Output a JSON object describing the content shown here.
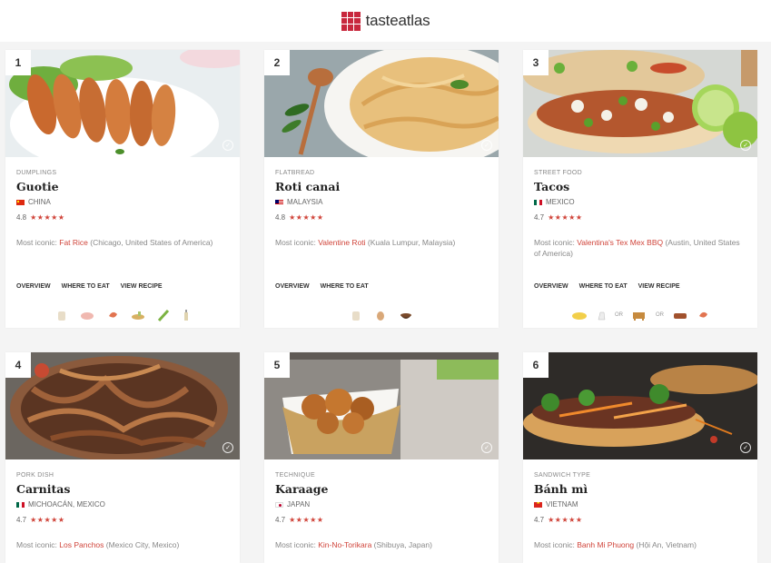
{
  "header": {
    "logo_text": "tasteatlas"
  },
  "labels": {
    "most_iconic": "Most iconic: ",
    "check": "✓"
  },
  "cards": [
    {
      "rank": "1",
      "category": "DUMPLINGS",
      "name": "Guotie",
      "country": "CHINA",
      "rating": "4.8",
      "stars": "★★★★★",
      "iconic_place": "Fat Rice",
      "iconic_location": " (Chicago, United States of America)",
      "actions": [
        "OVERVIEW",
        "WHERE TO EAT",
        "VIEW RECIPE"
      ]
    },
    {
      "rank": "2",
      "category": "FLATBREAD",
      "name": "Roti canai",
      "country": "MALAYSIA",
      "rating": "4.8",
      "stars": "★★★★★",
      "iconic_place": "Valentine Roti",
      "iconic_location": " (Kuala Lumpur, Malaysia)",
      "actions": [
        "OVERVIEW",
        "WHERE TO EAT"
      ]
    },
    {
      "rank": "3",
      "category": "STREET FOOD",
      "name": "Tacos",
      "country": "MEXICO",
      "rating": "4.7",
      "stars": "★★★★★",
      "iconic_place": "Valentina's Tex Mex BBQ",
      "iconic_location": " (Austin, United States of America)",
      "actions": [
        "OVERVIEW",
        "WHERE TO EAT",
        "VIEW RECIPE"
      ]
    },
    {
      "rank": "4",
      "category": "PORK DISH",
      "name": "Carnitas",
      "country": "MICHOACÁN, MEXICO",
      "rating": "4.7",
      "stars": "★★★★★",
      "iconic_place": "Los Panchos",
      "iconic_location": " (Mexico City, Mexico)"
    },
    {
      "rank": "5",
      "category": "TECHNIQUE",
      "name": "Karaage",
      "country": "JAPAN",
      "rating": "4.7",
      "stars": "★★★★★",
      "iconic_place": "Kin-No-Torikara",
      "iconic_location": " (Shibuya, Japan)"
    },
    {
      "rank": "6",
      "category": "SANDWICH TYPE",
      "name": "Bánh mì",
      "country": "VIETNAM",
      "rating": "4.7",
      "stars": "★★★★★",
      "iconic_place": "Banh Mi Phuong",
      "iconic_location": " (Hội An, Vietnam)"
    }
  ],
  "ingredients_or": "OR",
  "colors": {
    "accent": "#d0443a",
    "brand": "#c8273d",
    "background": "#f4f4f4"
  }
}
